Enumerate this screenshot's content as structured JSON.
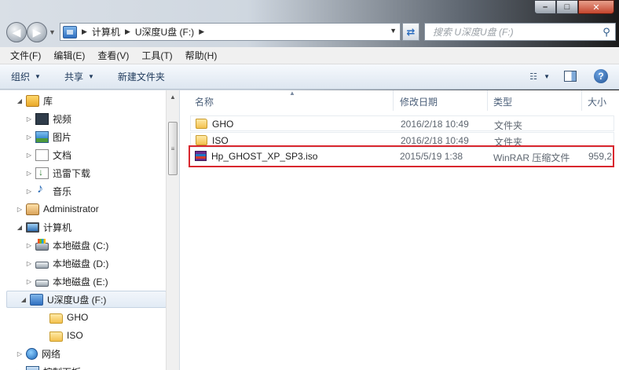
{
  "window": {
    "caption": {
      "minimize": "–",
      "maximize": "□",
      "close": "✕"
    }
  },
  "address": {
    "crumbs": [
      "计算机",
      "U深度U盘 (F:)"
    ],
    "search_placeholder": "搜索 U深度U盘 (F:)"
  },
  "menu": [
    "文件(F)",
    "编辑(E)",
    "查看(V)",
    "工具(T)",
    "帮助(H)"
  ],
  "toolbar": {
    "organize": "组织",
    "share": "共享",
    "new_folder": "新建文件夹"
  },
  "nav_tree": [
    {
      "label": "库",
      "icon": "library-icon",
      "expander": "◢",
      "indent": 0
    },
    {
      "label": "视频",
      "icon": "video-icon",
      "expander": "▷",
      "indent": 1
    },
    {
      "label": "图片",
      "icon": "picture-icon",
      "expander": "▷",
      "indent": 1
    },
    {
      "label": "文档",
      "icon": "document-icon",
      "expander": "▷",
      "indent": 1
    },
    {
      "label": "迅雷下载",
      "icon": "download-icon",
      "expander": "▷",
      "indent": 1
    },
    {
      "label": "音乐",
      "icon": "music-icon",
      "expander": "▷",
      "indent": 1
    },
    {
      "label": "Administrator",
      "icon": "user-folder-icon",
      "expander": "▷",
      "indent": 0
    },
    {
      "label": "计算机",
      "icon": "computer-icon",
      "expander": "◢",
      "indent": 0
    },
    {
      "label": "本地磁盘 (C:)",
      "icon": "system-drive-icon",
      "expander": "▷",
      "indent": 1
    },
    {
      "label": "本地磁盘 (D:)",
      "icon": "drive-icon",
      "expander": "▷",
      "indent": 1
    },
    {
      "label": "本地磁盘 (E:)",
      "icon": "drive-icon",
      "expander": "▷",
      "indent": 1
    },
    {
      "label": "U深度U盘 (F:)",
      "icon": "usb-drive-icon",
      "expander": "◢",
      "indent": 1,
      "selected": true
    },
    {
      "label": "GHO",
      "icon": "folder-icon",
      "expander": "",
      "indent": 2
    },
    {
      "label": "ISO",
      "icon": "folder-icon",
      "expander": "",
      "indent": 2
    },
    {
      "label": "网络",
      "icon": "network-icon",
      "expander": "▷",
      "indent": 0
    },
    {
      "label": "控制面板",
      "icon": "control-panel-icon",
      "expander": "▷",
      "indent": 0
    }
  ],
  "columns": {
    "name": "名称",
    "modified": "修改日期",
    "type": "类型",
    "size": "大小"
  },
  "files": [
    {
      "name": "GHO",
      "modified": "2016/2/18 10:49",
      "type": "文件夹",
      "size": "",
      "icon": "folder-icon"
    },
    {
      "name": "ISO",
      "modified": "2016/2/18 10:49",
      "type": "文件夹",
      "size": "",
      "icon": "folder-icon"
    },
    {
      "name": "Hp_GHOST_XP_SP3.iso",
      "modified": "2015/5/19 1:38",
      "type": "WinRAR 压缩文件",
      "size": "959,2",
      "icon": "winrar-archive-icon",
      "highlighted": true
    }
  ],
  "colors": {
    "highlight": "#d9272e",
    "toolbar_text": "#1e395b"
  }
}
